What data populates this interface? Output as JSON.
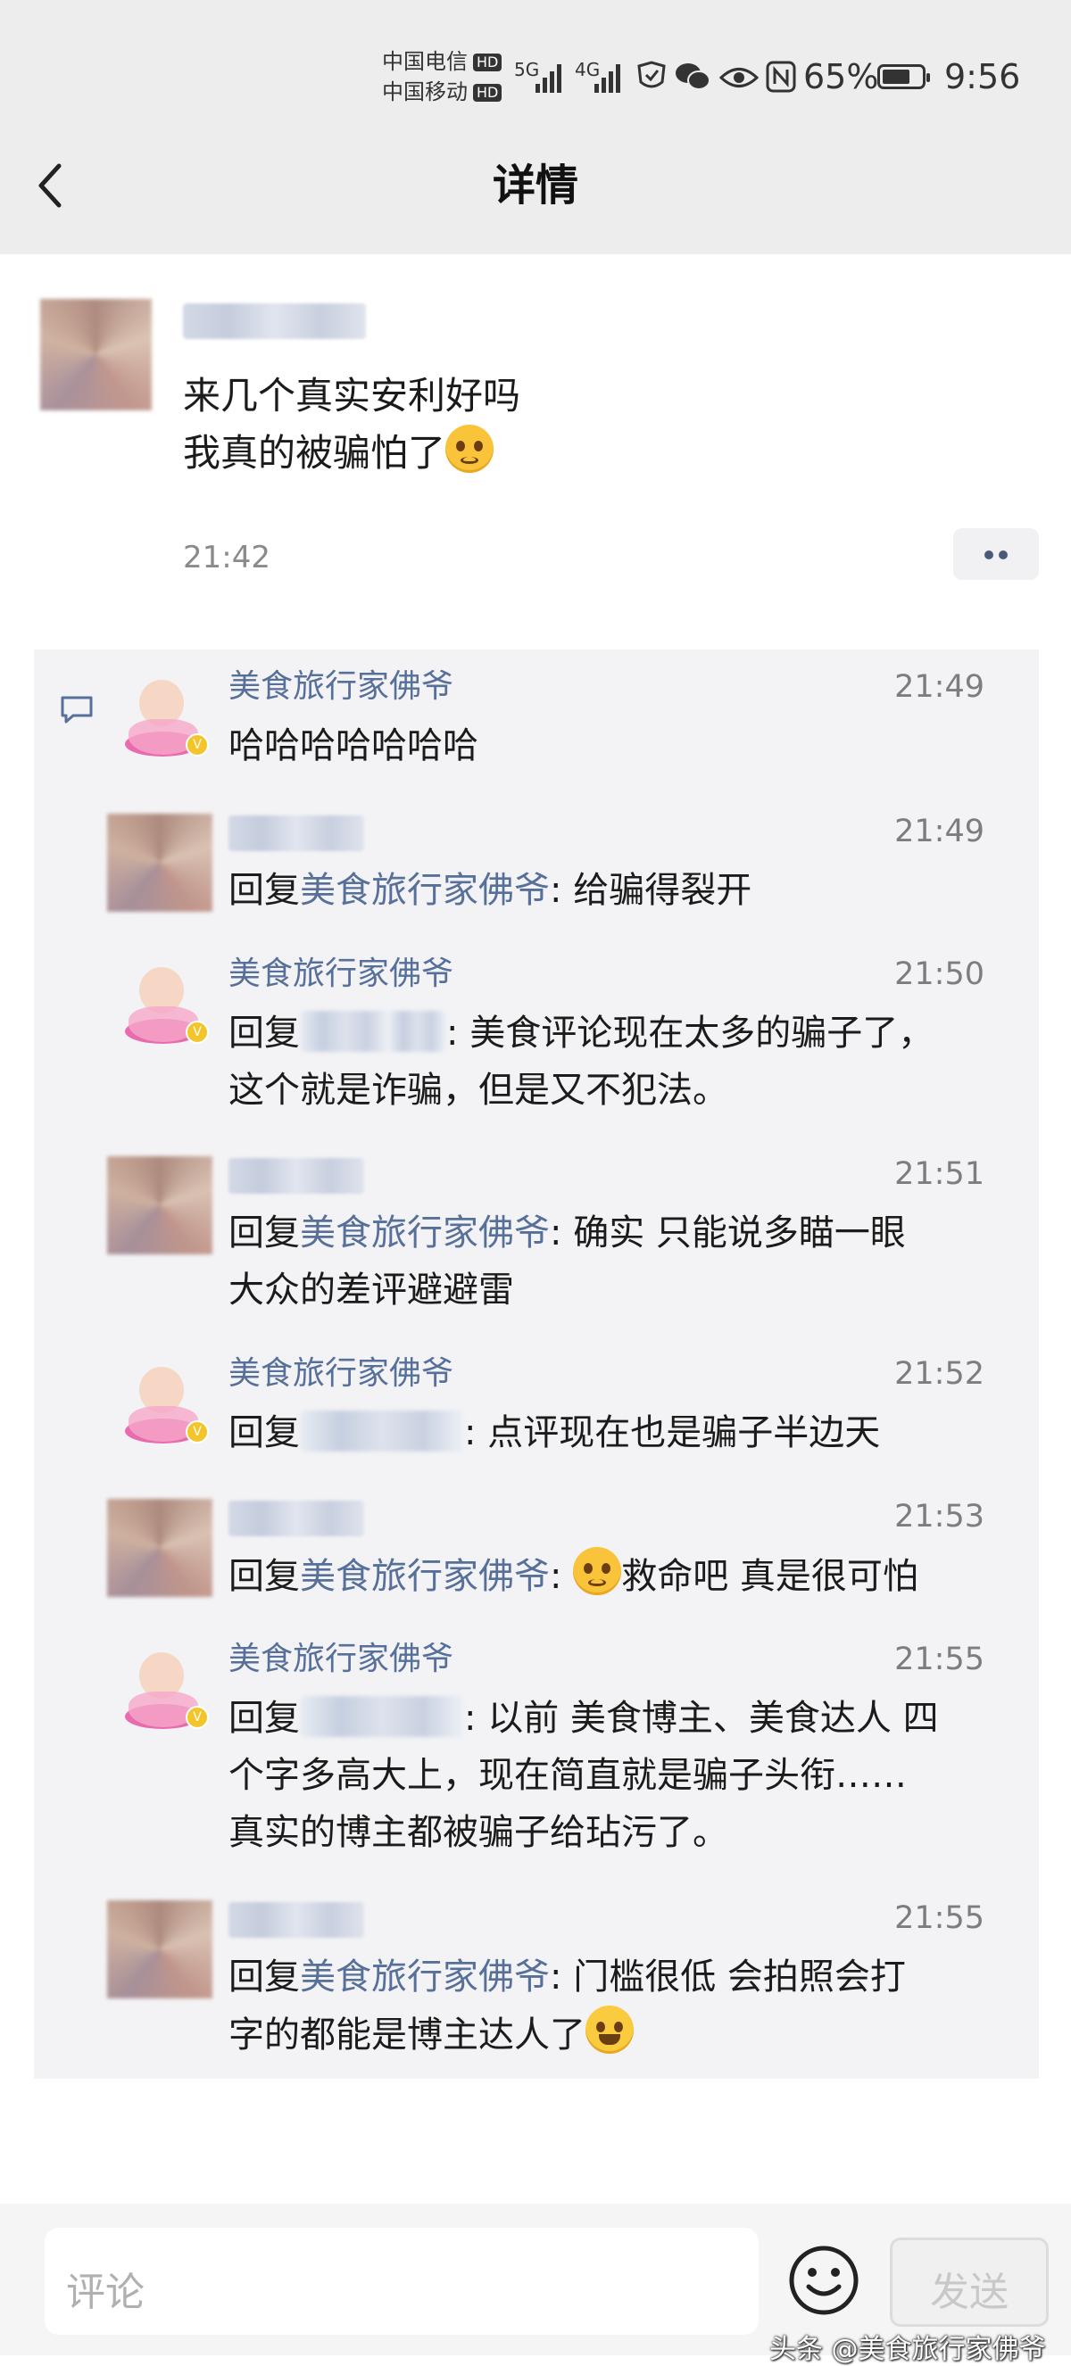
{
  "status_bar": {
    "carrier1": "中国电信",
    "carrier2": "中国移动",
    "hd": "HD",
    "net1": "5G",
    "net2": "4G",
    "battery": "65%",
    "battery_level": 0.65,
    "time": "9:56",
    "icons": [
      "wifi-shield-icon",
      "wechat-icon",
      "eye-icon",
      "nfc-icon"
    ]
  },
  "header": {
    "title": "详情",
    "back_icon": "chevron-left-icon"
  },
  "post": {
    "line1": "来几个真实安利好吗",
    "line2": "我真的被骗怕了",
    "time": "21:42"
  },
  "comments": [
    {
      "name": "美食旅行家佛爷",
      "time": "21:49",
      "text": "哈哈哈哈哈哈哈"
    },
    {
      "name": "",
      "time": "21:49",
      "prefix": "回复",
      "target": "美食旅行家佛爷",
      "text": ": 给骗得裂开"
    },
    {
      "name": "美食旅行家佛爷",
      "time": "21:50",
      "prefix": "回复",
      "text": ": 美食评论现在太多的骗子了，",
      "text2": "这个就是诈骗，但是又不犯法。"
    },
    {
      "name": "",
      "time": "21:51",
      "prefix": "回复",
      "target": "美食旅行家佛爷",
      "text": ": 确实 只能说多瞄一眼",
      "text2": "大众的差评避避雷"
    },
    {
      "name": "美食旅行家佛爷",
      "time": "21:52",
      "prefix": "回复",
      "text": ": 点评现在也是骗子半边天"
    },
    {
      "name": "",
      "time": "21:53",
      "prefix": "回复",
      "target": "美食旅行家佛爷",
      "text": ": ",
      "text_after": "救命吧 真是很可怕"
    },
    {
      "name": "美食旅行家佛爷",
      "time": "21:55",
      "prefix": "回复",
      "text": ": 以前 美食博主、美食达人 四",
      "text2": "个字多高大上，现在简直就是骗子头衔……",
      "text3": "真实的博主都被骗子给玷污了。"
    },
    {
      "name": "",
      "time": "21:55",
      "prefix": "回复",
      "target": "美食旅行家佛爷",
      "text": ": 门槛很低 会拍照会打",
      "text2": "字的都能是博主达人了"
    }
  ],
  "footer": {
    "comment_placeholder": "评论",
    "send_label": "发送",
    "watermark": "头条 @美食旅行家佛爷"
  }
}
